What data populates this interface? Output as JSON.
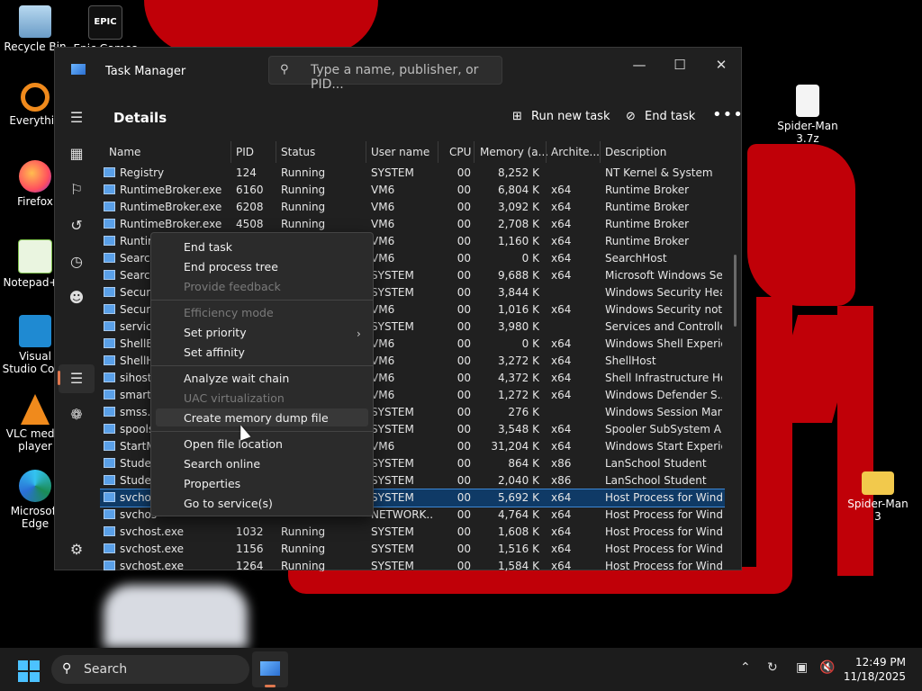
{
  "desktop": {
    "icons": [
      {
        "label": "Recycle Bin"
      },
      {
        "label": "Epic Games"
      },
      {
        "label": "Everythin"
      },
      {
        "label": "Firefox"
      },
      {
        "label": "Notepad++"
      },
      {
        "label": "Visual Studio Code"
      },
      {
        "label": "VLC media player"
      },
      {
        "label": "Microsoft Edge"
      },
      {
        "label": "Spider-Man 3.7z"
      },
      {
        "label": "Spider-Man 3"
      }
    ]
  },
  "window": {
    "title": "Task Manager",
    "search_placeholder": "Type a name, publisher, or PID...",
    "minimize": "—",
    "maximize": "☐",
    "close": "✕"
  },
  "page": {
    "title": "Details",
    "run_new_task": "Run new task",
    "end_task": "End task",
    "more": "•••"
  },
  "table": {
    "columns": [
      "Name",
      "PID",
      "Status",
      "User name",
      "CPU",
      "Memory (a...",
      "Archite...",
      "Description"
    ],
    "rows": [
      {
        "name": "Registry",
        "pid": "124",
        "status": "Running",
        "user": "SYSTEM",
        "cpu": "00",
        "mem": "8,252 K",
        "arch": "",
        "desc": "NT Kernel & System"
      },
      {
        "name": "RuntimeBroker.exe",
        "pid": "6160",
        "status": "Running",
        "user": "VM6",
        "cpu": "00",
        "mem": "6,804 K",
        "arch": "x64",
        "desc": "Runtime Broker"
      },
      {
        "name": "RuntimeBroker.exe",
        "pid": "6208",
        "status": "Running",
        "user": "VM6",
        "cpu": "00",
        "mem": "3,092 K",
        "arch": "x64",
        "desc": "Runtime Broker"
      },
      {
        "name": "RuntimeBroker.exe",
        "pid": "4508",
        "status": "Running",
        "user": "VM6",
        "cpu": "00",
        "mem": "2,708 K",
        "arch": "x64",
        "desc": "Runtime Broker"
      },
      {
        "name": "Runtim",
        "pid": "",
        "status": "",
        "user": "VM6",
        "cpu": "00",
        "mem": "1,160 K",
        "arch": "x64",
        "desc": "Runtime Broker"
      },
      {
        "name": "Search",
        "pid": "",
        "status": "",
        "user": "VM6",
        "cpu": "00",
        "mem": "0 K",
        "arch": "x64",
        "desc": "SearchHost"
      },
      {
        "name": "Search",
        "pid": "",
        "status": "",
        "user": "SYSTEM",
        "cpu": "00",
        "mem": "9,688 K",
        "arch": "x64",
        "desc": "Microsoft Windows Se..."
      },
      {
        "name": "Securit",
        "pid": "",
        "status": "",
        "user": "SYSTEM",
        "cpu": "00",
        "mem": "3,844 K",
        "arch": "",
        "desc": "Windows Security Hea..."
      },
      {
        "name": "Securit",
        "pid": "",
        "status": "",
        "user": "VM6",
        "cpu": "00",
        "mem": "1,016 K",
        "arch": "x64",
        "desc": "Windows Security noti..."
      },
      {
        "name": "service",
        "pid": "",
        "status": "",
        "user": "SYSTEM",
        "cpu": "00",
        "mem": "3,980 K",
        "arch": "",
        "desc": "Services and Controlle..."
      },
      {
        "name": "ShellEx",
        "pid": "",
        "status": "",
        "user": "VM6",
        "cpu": "00",
        "mem": "0 K",
        "arch": "x64",
        "desc": "Windows Shell Experie..."
      },
      {
        "name": "ShellH",
        "pid": "",
        "status": "",
        "user": "VM6",
        "cpu": "00",
        "mem": "3,272 K",
        "arch": "x64",
        "desc": "ShellHost"
      },
      {
        "name": "sihost.",
        "pid": "",
        "status": "",
        "user": "VM6",
        "cpu": "00",
        "mem": "4,372 K",
        "arch": "x64",
        "desc": "Shell Infrastructure Host"
      },
      {
        "name": "smarts",
        "pid": "",
        "status": "",
        "user": "VM6",
        "cpu": "00",
        "mem": "1,272 K",
        "arch": "x64",
        "desc": "Windows Defender S..."
      },
      {
        "name": "smss.e",
        "pid": "",
        "status": "",
        "user": "SYSTEM",
        "cpu": "00",
        "mem": "276 K",
        "arch": "",
        "desc": "Windows Session Man..."
      },
      {
        "name": "spools",
        "pid": "",
        "status": "",
        "user": "SYSTEM",
        "cpu": "00",
        "mem": "3,548 K",
        "arch": "x64",
        "desc": "Spooler SubSystem App"
      },
      {
        "name": "StartM",
        "pid": "",
        "status": "",
        "user": "VM6",
        "cpu": "00",
        "mem": "31,204 K",
        "arch": "x64",
        "desc": "Windows Start Experie..."
      },
      {
        "name": "Studer",
        "pid": "",
        "status": "",
        "user": "SYSTEM",
        "cpu": "00",
        "mem": "864 K",
        "arch": "x86",
        "desc": "LanSchool Student"
      },
      {
        "name": "Studer",
        "pid": "",
        "status": "",
        "user": "SYSTEM",
        "cpu": "00",
        "mem": "2,040 K",
        "arch": "x86",
        "desc": "LanSchool Student"
      },
      {
        "name": "svchost",
        "pid": "",
        "status": "",
        "user": "SYSTEM",
        "cpu": "00",
        "mem": "5,692 K",
        "arch": "x64",
        "desc": "Host Process for Wind..."
      },
      {
        "name": "svchos",
        "pid": "",
        "status": "",
        "user": "NETWORK...",
        "cpu": "00",
        "mem": "4,764 K",
        "arch": "x64",
        "desc": "Host Process for Wind..."
      },
      {
        "name": "svchost.exe",
        "pid": "1032",
        "status": "Running",
        "user": "SYSTEM",
        "cpu": "00",
        "mem": "1,608 K",
        "arch": "x64",
        "desc": "Host Process for Wind..."
      },
      {
        "name": "svchost.exe",
        "pid": "1156",
        "status": "Running",
        "user": "SYSTEM",
        "cpu": "00",
        "mem": "1,516 K",
        "arch": "x64",
        "desc": "Host Process for Wind..."
      },
      {
        "name": "svchost.exe",
        "pid": "1264",
        "status": "Running",
        "user": "SYSTEM",
        "cpu": "00",
        "mem": "1,584 K",
        "arch": "x64",
        "desc": "Host Process for Wind..."
      }
    ],
    "selected_index": 19
  },
  "context_menu": {
    "items": [
      {
        "label": "End task",
        "disabled": false
      },
      {
        "label": "End process tree",
        "disabled": false
      },
      {
        "label": "Provide feedback",
        "disabled": true
      },
      {
        "label": "Efficiency mode",
        "disabled": true
      },
      {
        "label": "Set priority",
        "disabled": false
      },
      {
        "label": "Set affinity",
        "disabled": false
      },
      {
        "label": "Analyze wait chain",
        "disabled": false
      },
      {
        "label": "UAC virtualization",
        "disabled": true
      },
      {
        "label": "Create memory dump file",
        "disabled": false
      },
      {
        "label": "Open file location",
        "disabled": false
      },
      {
        "label": "Search online",
        "disabled": false
      },
      {
        "label": "Properties",
        "disabled": false
      },
      {
        "label": "Go to service(s)",
        "disabled": false
      }
    ]
  },
  "taskbar": {
    "search_label": "Search",
    "time": "12:49 PM",
    "date": "11/18/2025"
  },
  "colors": {
    "accent": "#e0784f",
    "selection": "#0f3a66",
    "wallpaper_red": "#c00008"
  }
}
